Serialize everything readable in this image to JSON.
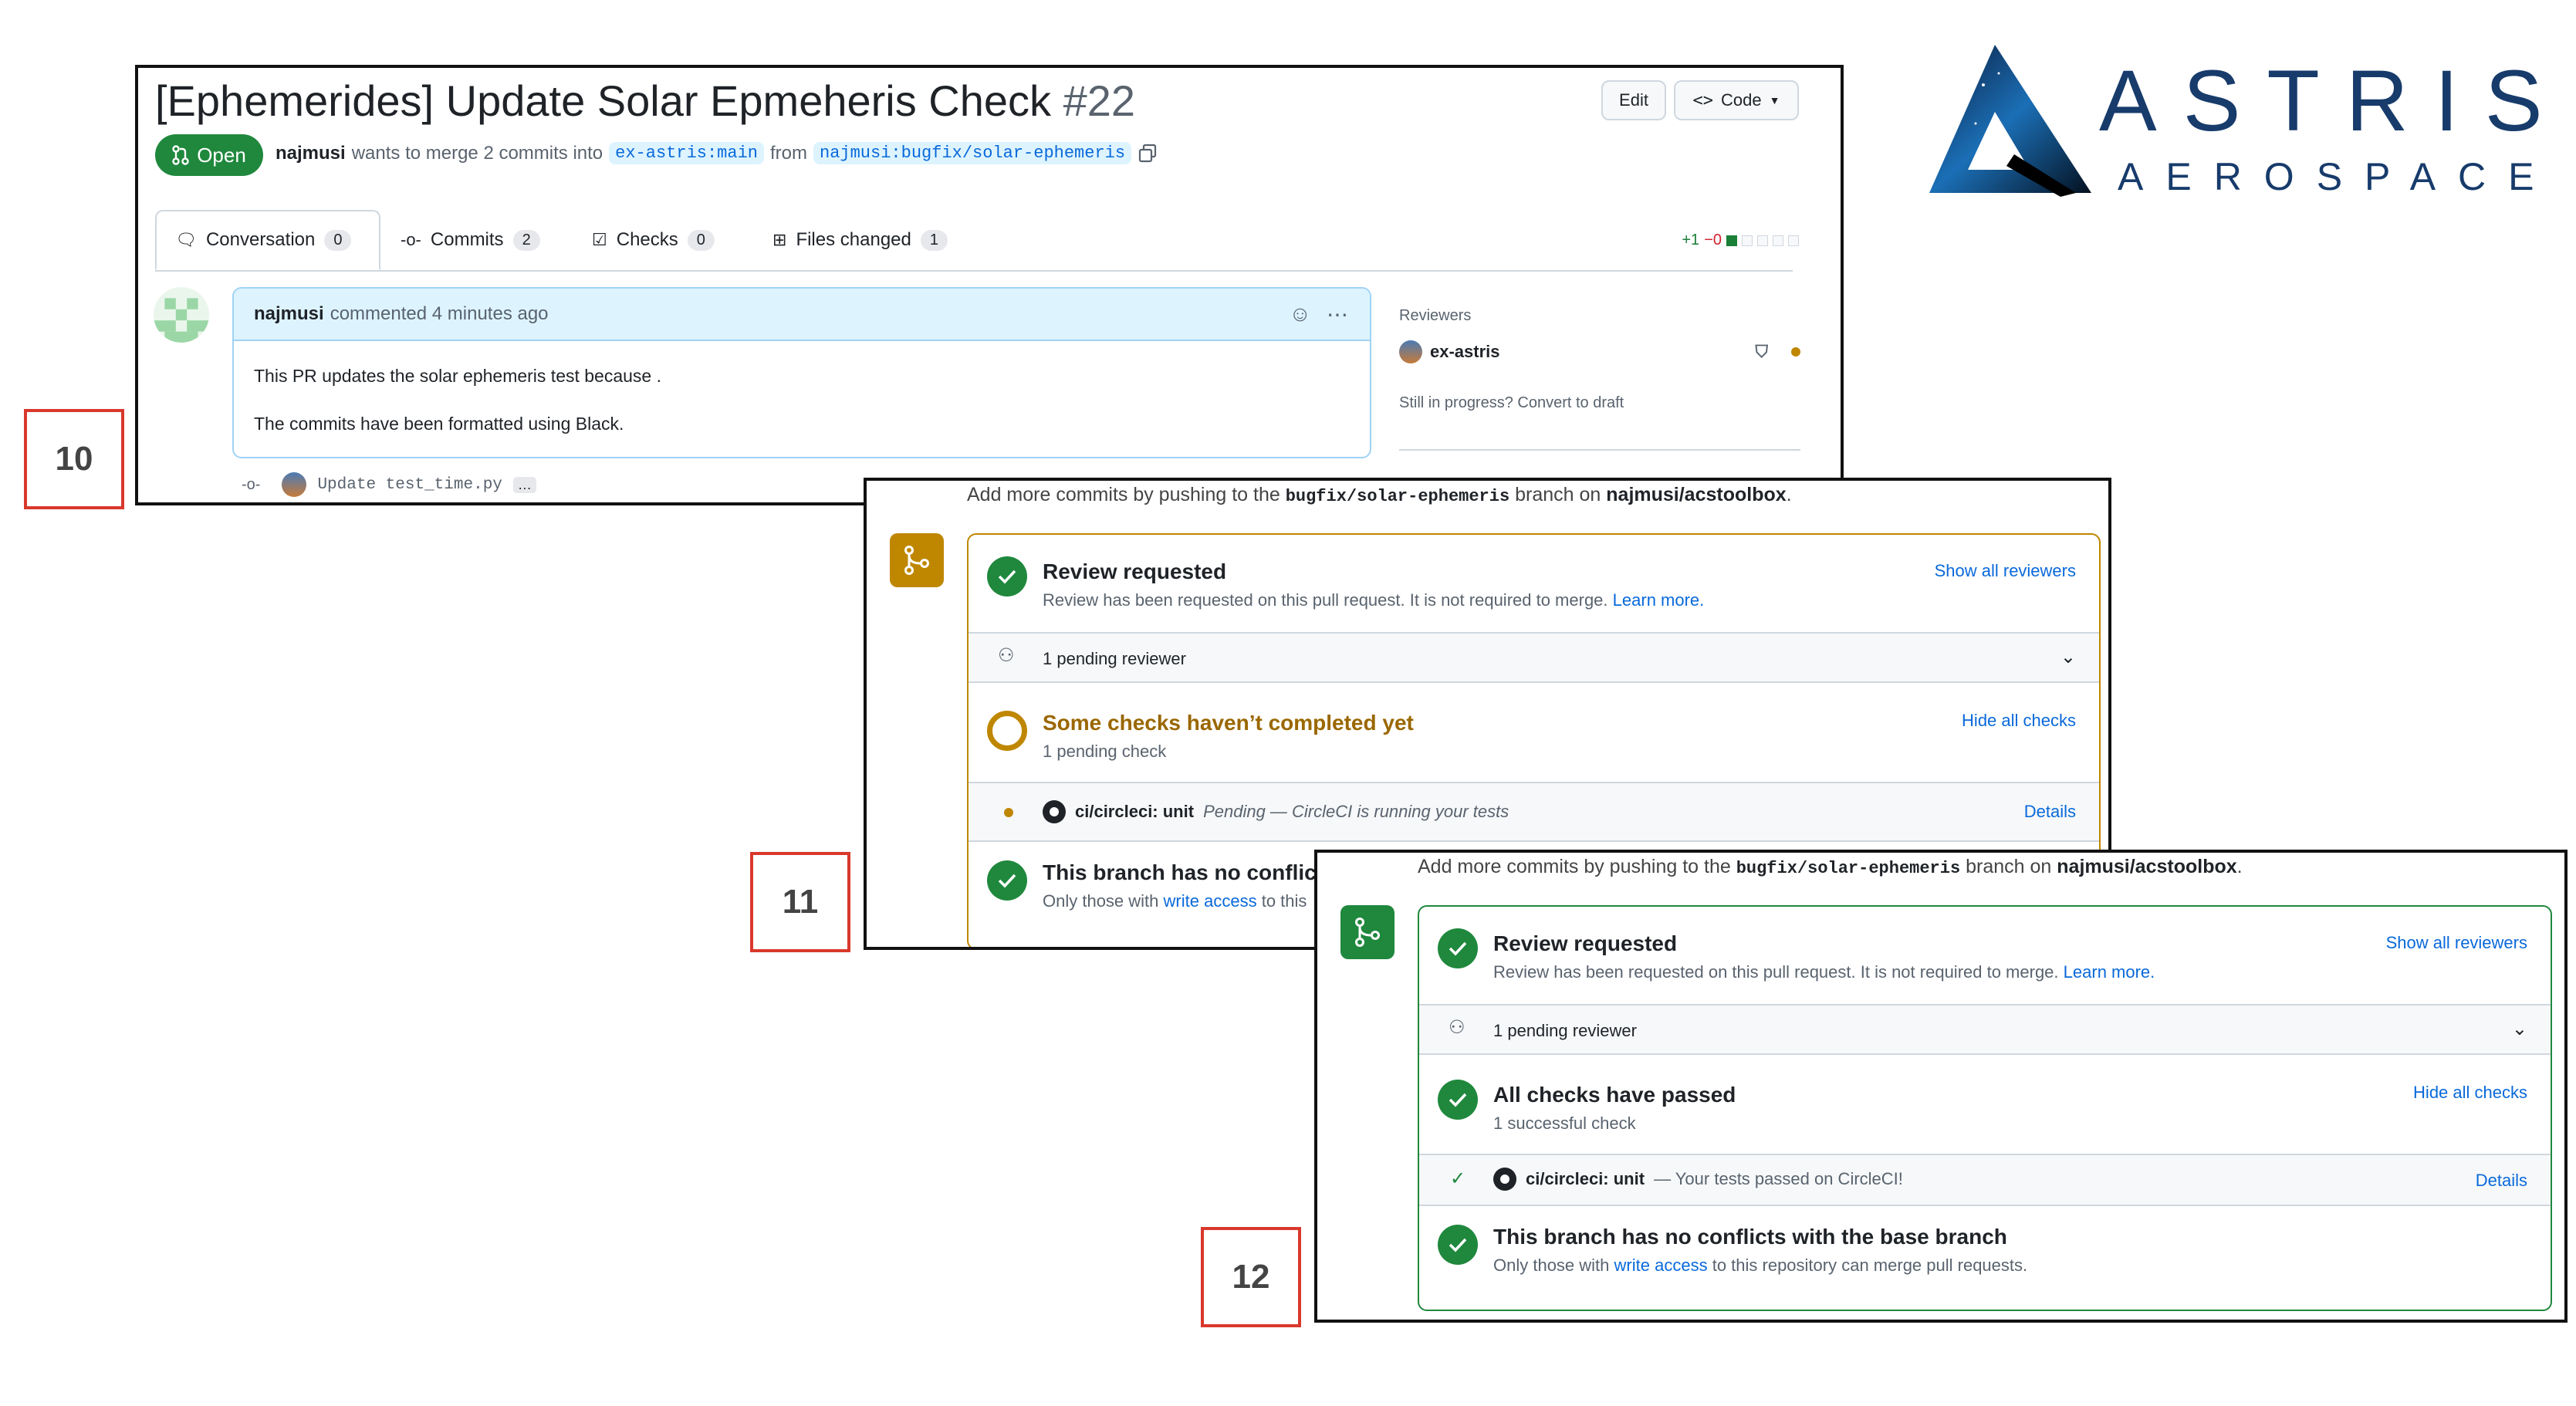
{
  "logo": {
    "line1": "ASTRIS",
    "line2": "AEROSPACE"
  },
  "steps": [
    "10",
    "11",
    "12"
  ],
  "pr": {
    "title": "[Ephemerides] Update Solar Epmeheris Check",
    "number": "#22",
    "edit_label": "Edit",
    "code_label": "Code",
    "state": "Open",
    "author": "najmusi",
    "merge_text": "wants to merge 2 commits into",
    "base_branch": "ex-astris:main",
    "from_text": "from",
    "head_branch": "najmusi:bugfix/solar-ephemeris",
    "tabs": [
      {
        "label": "Conversation",
        "count": "0"
      },
      {
        "label": "Commits",
        "count": "2"
      },
      {
        "label": "Checks",
        "count": "0"
      },
      {
        "label": "Files changed",
        "count": "1"
      }
    ],
    "diff_add": "+1",
    "diff_del": "−0",
    "comment": {
      "author": "najmusi",
      "meta": "commented 4 minutes ago",
      "body1": "This PR updates the solar ephemeris test because .",
      "body2": "The commits have been formatted using Black."
    },
    "reviewers_heading": "Reviewers",
    "reviewer": "ex-astris",
    "draft_note": "Still in progress? Convert to draft",
    "commit_message": "Update test_time.py",
    "commit_more": "…"
  },
  "merge_note": {
    "prefix": "Add more commits by pushing to the",
    "branch": "bugfix/solar-ephemeris",
    "mid": "branch on",
    "repo": "najmusi/acstoolbox",
    "suffix": "."
  },
  "panel11": {
    "review_title": "Review requested",
    "review_sub": "Review has been requested on this pull request. It is not required to merge.",
    "learn_more": "Learn more.",
    "show_reviewers": "Show all reviewers",
    "pending_reviewer": "1 pending reviewer",
    "checks_title": "Some checks haven’t completed yet",
    "checks_sub": "1 pending check",
    "hide_checks": "Hide all checks",
    "ci_name": "ci/circleci: unit",
    "ci_status": "Pending — CircleCI is running your tests",
    "details": "Details",
    "conflict_title": "This branch has no conflicts",
    "conflict_sub_prefix": "Only those with",
    "write_access": "write access",
    "conflict_sub_suffix": "to this"
  },
  "panel12": {
    "review_title": "Review requested",
    "review_sub": "Review has been requested on this pull request. It is not required to merge.",
    "learn_more": "Learn more.",
    "show_reviewers": "Show all reviewers",
    "pending_reviewer": "1 pending reviewer",
    "checks_title": "All checks have passed",
    "checks_sub": "1 successful check",
    "hide_checks": "Hide all checks",
    "ci_name": "ci/circleci: unit",
    "ci_status": "— Your tests passed on CircleCI!",
    "details": "Details",
    "conflict_title": "This branch has no conflicts with the base branch",
    "conflict_sub_prefix": "Only those with",
    "write_access": "write access",
    "conflict_sub_suffix": "to this repository can merge pull requests."
  },
  "colors": {
    "green": "#1f883d",
    "amber": "#bf8700",
    "link": "#0969da",
    "step_border": "#d9382c"
  }
}
